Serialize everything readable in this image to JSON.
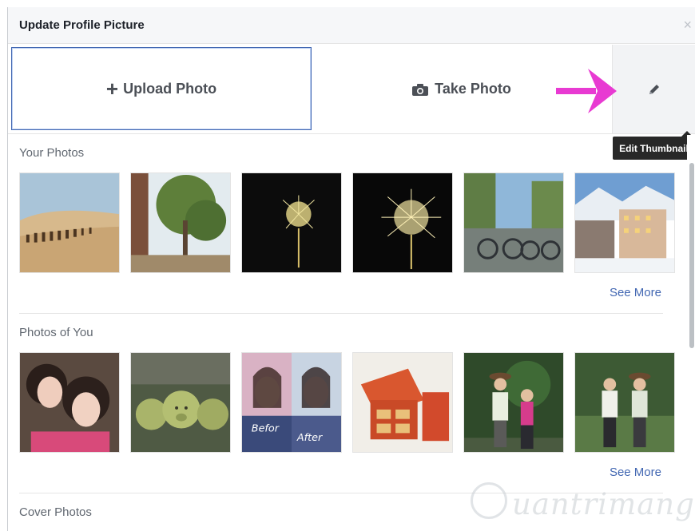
{
  "dialog": {
    "title": "Update Profile Picture",
    "close_glyph": "×"
  },
  "actions": {
    "upload_label": "Upload Photo",
    "upload_glyph": "+",
    "take_label": "Take Photo",
    "edit_icon": "pencil-icon",
    "camera_icon": "camera-icon"
  },
  "tooltip": {
    "text": "Edit Thumbnail"
  },
  "sections": [
    {
      "heading": "Your Photos",
      "see_more": "See More",
      "photos": [
        {
          "name": "desert-camels",
          "sky": "#a9c4d8",
          "ground": "#d4b68a"
        },
        {
          "name": "tree-terrace",
          "sky": "#dfe9ef",
          "ground": "#6a8a4a"
        },
        {
          "name": "fireworks-1",
          "sky": "#0c0c0c",
          "ground": "#1b1b1b"
        },
        {
          "name": "fireworks-2",
          "sky": "#080808",
          "ground": "#141414"
        },
        {
          "name": "bicycles-street",
          "sky": "#8fb7d9",
          "ground": "#6f7a72"
        },
        {
          "name": "snowy-town",
          "sky": "#7ba6d6",
          "ground": "#e8eef3"
        }
      ]
    },
    {
      "heading": "Photos of You",
      "see_more": "See More",
      "photos": [
        {
          "name": "two-girls-selfie",
          "sky": "#5a4a40",
          "ground": "#e7c3b2"
        },
        {
          "name": "pig-fruits",
          "sky": "#4f5a44",
          "ground": "#a9b46a"
        },
        {
          "name": "before-after",
          "sky": "#d9b2c4",
          "ground": "#3a4a7a",
          "labels": [
            "Befor",
            "After"
          ]
        },
        {
          "name": "gift-boxes",
          "sky": "#f1eee8",
          "ground": "#d1482b"
        },
        {
          "name": "couple-tree",
          "sky": "#2f4a2a",
          "ground": "#c9b89c"
        },
        {
          "name": "two-men-garden",
          "sky": "#3d5a34",
          "ground": "#c7c9b9"
        }
      ]
    },
    {
      "heading": "Cover Photos"
    }
  ],
  "watermark": {
    "text": "uantrimang"
  }
}
